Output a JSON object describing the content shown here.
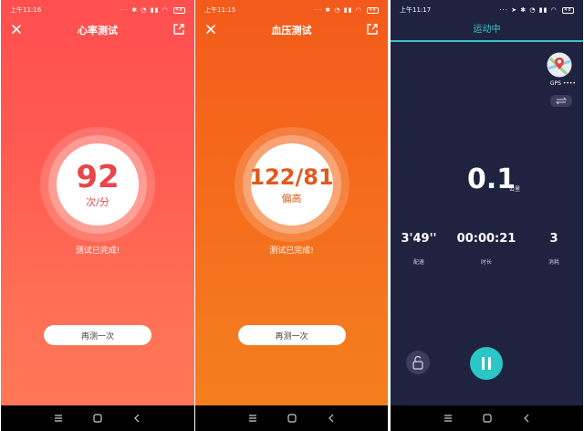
{
  "screen1": {
    "status": {
      "time": "上午11:16",
      "battery": "48"
    },
    "title": "心率测试",
    "value": "92",
    "unit": "次/分",
    "done_text": "测试已完成!",
    "retry_label": "再测一次",
    "value_color": "#e8464a"
  },
  "screen2": {
    "status": {
      "time": "上午11:15",
      "battery": "48"
    },
    "title": "血压测试",
    "value": "122/81",
    "unit": "偏高",
    "done_text": "测试已完成!",
    "retry_label": "再测一次",
    "value_color": "#e05a1d"
  },
  "screen3": {
    "status": {
      "time": "上午11:17",
      "battery": "48"
    },
    "title": "运动中",
    "gps_label": "GPS ••••",
    "distance": "0.1",
    "distance_unit": "公里",
    "stats": [
      {
        "value": "3'49''",
        "label": "配速"
      },
      {
        "value": "00:00:21",
        "label": "时长"
      },
      {
        "value": "3",
        "label": "消耗"
      }
    ],
    "accent": "#2bc6c6"
  },
  "icons": [
    "close-icon",
    "share-icon",
    "map-pin-icon",
    "swap-icon",
    "unlock-icon",
    "pause-icon",
    "menu-icon",
    "home-icon",
    "back-icon"
  ]
}
